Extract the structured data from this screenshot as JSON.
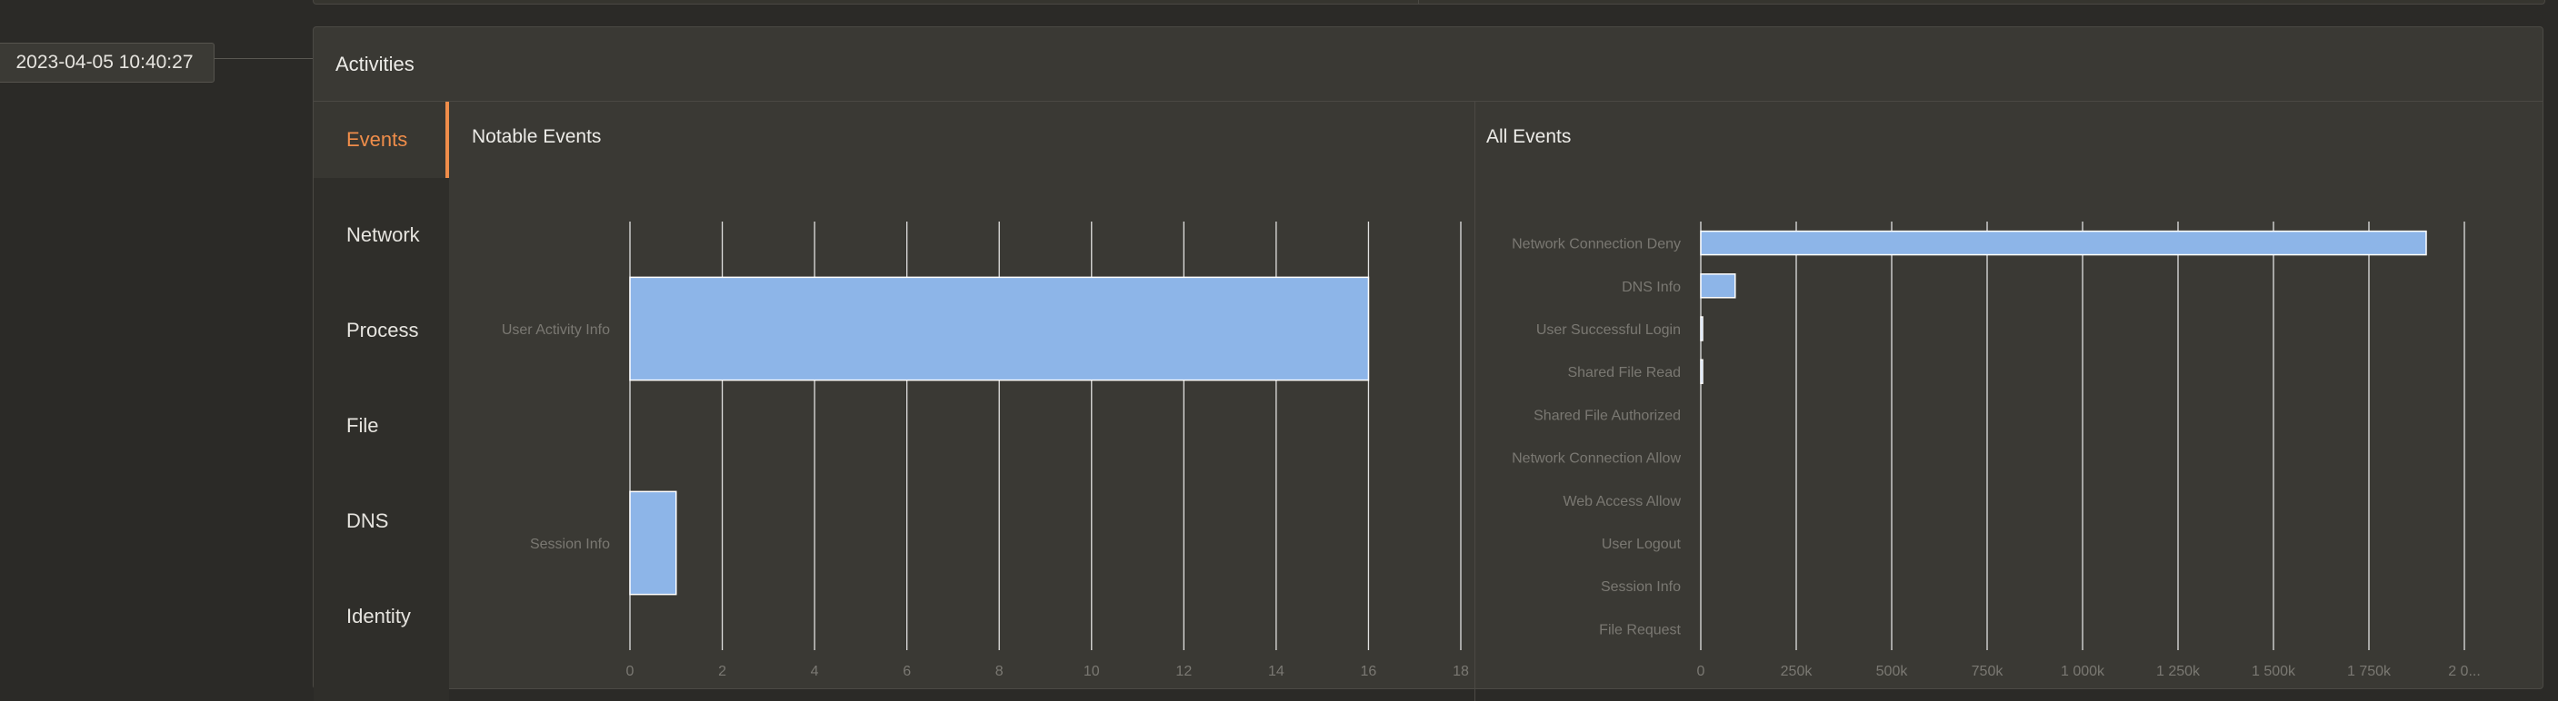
{
  "timestamp": "2023-04-05 10:40:27",
  "panel": {
    "title": "Activities"
  },
  "sidebar": {
    "tabs": [
      {
        "label": "Events",
        "active": true
      },
      {
        "label": "Network",
        "active": false
      },
      {
        "label": "Process",
        "active": false
      },
      {
        "label": "File",
        "active": false
      },
      {
        "label": "DNS",
        "active": false
      },
      {
        "label": "Identity",
        "active": false
      }
    ]
  },
  "colors": {
    "accent": "#f08d4a",
    "bar": "#8db5e8",
    "bar_stroke": "#ffffff",
    "grid": "#ffffff",
    "tick_text": "#7a7872"
  },
  "chart_data": [
    {
      "type": "bar",
      "orientation": "horizontal",
      "title": "Notable Events",
      "categories": [
        "User Activity Info",
        "Session Info"
      ],
      "values": [
        16,
        1
      ],
      "xlim": [
        0,
        18
      ],
      "xticks": [
        "0",
        "2",
        "4",
        "6",
        "8",
        "10",
        "12",
        "14",
        "16",
        "18"
      ],
      "grid": true
    },
    {
      "type": "bar",
      "orientation": "horizontal",
      "title": "All Events",
      "categories": [
        "Network Connection Deny",
        "DNS Info",
        "User Successful Login",
        "Shared File Read",
        "Shared File Authorized",
        "Network Connection Allow",
        "Web Access Allow",
        "User Logout",
        "Session Info",
        "File Request"
      ],
      "values": [
        1900000,
        90000,
        4000,
        3000,
        0,
        0,
        0,
        0,
        0,
        0
      ],
      "xlim": [
        0,
        2000000
      ],
      "xticks": [
        "0",
        "250k",
        "500k",
        "750k",
        "1 000k",
        "1 250k",
        "1 500k",
        "1 750k",
        "2 0..."
      ],
      "grid": true
    }
  ]
}
